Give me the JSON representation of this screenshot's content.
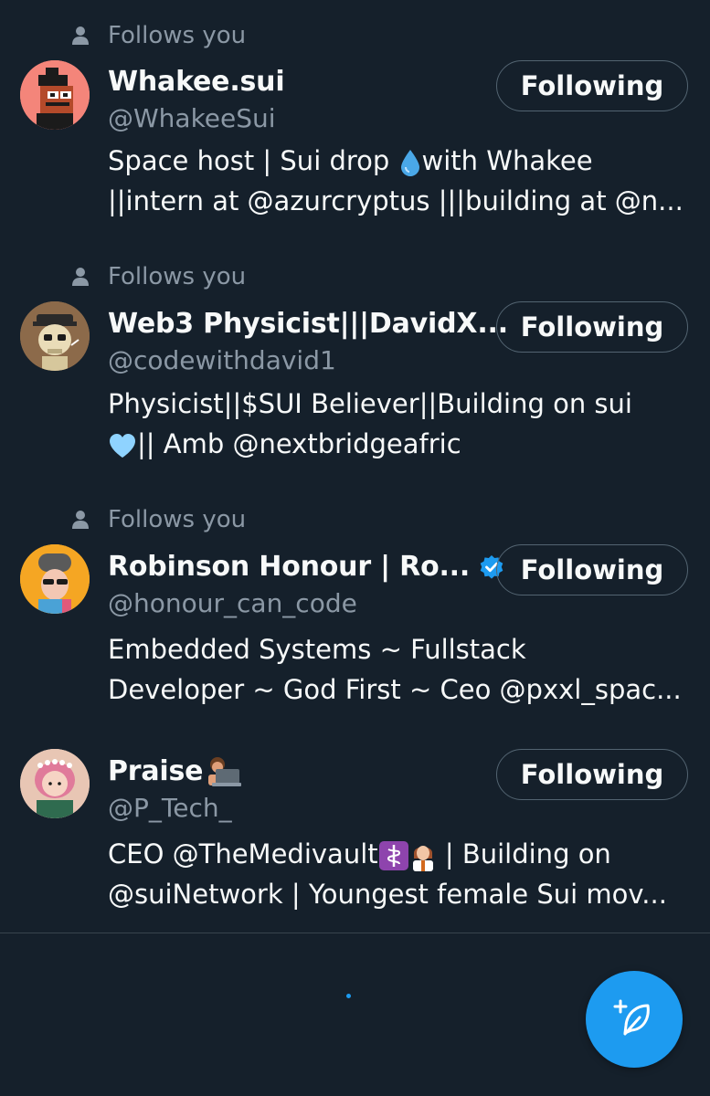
{
  "colors": {
    "background": "#15202b",
    "text_primary": "#f7f9f9",
    "text_secondary": "#8b98a5",
    "accent": "#1d9bf0",
    "border": "#536471"
  },
  "users": [
    {
      "follows_label": "Follows you",
      "name": "Whakee.sui",
      "handle": "@WhakeeSui",
      "verified": false,
      "button_label": "Following",
      "bio_line1_a": "Space host | Sui drop ",
      "bio_line1_emoji": "droplet",
      "bio_line1_b": "with Whakee",
      "bio_line2": "||intern at @azurcryptus |||building at @n...",
      "avatar_icon": "pixel-avatar-icon"
    },
    {
      "follows_label": "Follows you",
      "name": "Web3 Physicist|||DavidX...",
      "handle": "@codewithdavid1",
      "verified": false,
      "button_label": "Following",
      "bio_line1": "Physicist||$SUI Believer||Building on sui",
      "bio_line2_emoji": "light-blue-heart",
      "bio_line2": "|| Amb @nextbridgeafric",
      "avatar_icon": "skull-avatar-icon"
    },
    {
      "follows_label": "Follows you",
      "name": "Robinson Honour | Ro...",
      "handle": "@honour_can_code",
      "verified": true,
      "button_label": "Following",
      "bio_line1": "Embedded Systems ~ Fullstack",
      "bio_line2": "Developer ~ God First ~ Ceo @pxxl_spac...",
      "avatar_icon": "beanie-avatar-icon"
    },
    {
      "follows_label": "",
      "name": "Praise",
      "name_emoji": "technologist",
      "handle": "@P_Tech_",
      "verified": false,
      "button_label": "Following",
      "bio_line1_a": "CEO @TheMedivault",
      "bio_line1_emoji": "medical-symbol",
      "bio_line1_b": " | Building on",
      "bio_line2": "@suiNetwork | Youngest female Sui mov...",
      "avatar_icon": "flower-crown-avatar-icon"
    }
  ],
  "fab": {
    "icon": "compose-feather-icon"
  }
}
